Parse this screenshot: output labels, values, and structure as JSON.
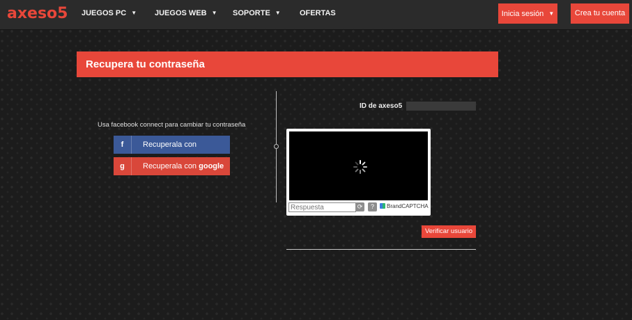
{
  "brand": {
    "logo_text": "axeso5",
    "accent_color": "#e8473a"
  },
  "nav": {
    "items": [
      {
        "label": "JUEGOS PC",
        "has_dropdown": true
      },
      {
        "label": "JUEGOS WEB",
        "has_dropdown": true
      },
      {
        "label": "SOPORTE",
        "has_dropdown": true
      },
      {
        "label": "OFERTAS",
        "has_dropdown": false
      }
    ],
    "login_label": "Inicia sesión",
    "register_label": "Crea tu cuenta"
  },
  "panel": {
    "title": "Recupera tu contraseña"
  },
  "social": {
    "prompt": "Usa facebook connect para cambiar tu contraseña",
    "facebook": {
      "icon_letter": "f",
      "label": "Recuperala con",
      "brand": "facebook",
      "color": "#3b5998"
    },
    "google": {
      "icon_letter": "g",
      "label": "Recuperala con",
      "brand": "google",
      "color": "#d9473a"
    }
  },
  "form": {
    "id_label": "ID de axeso5",
    "id_value": "",
    "captcha": {
      "answer_placeholder": "Respuesta",
      "answer_value": "",
      "provider": "BrandCAPTCHA",
      "refresh_icon": "refresh-icon",
      "help_icon": "help-icon",
      "status": "loading"
    },
    "submit_label": "Verificar usuario"
  }
}
